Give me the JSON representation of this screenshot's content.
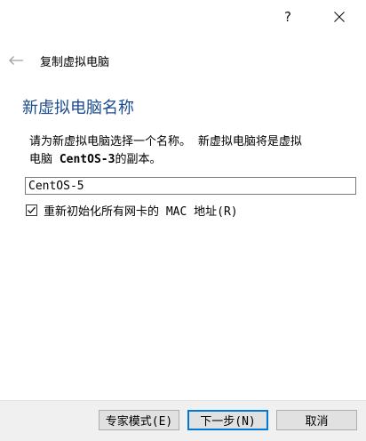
{
  "titlebar": {
    "help_label": "?"
  },
  "header": {
    "title": "复制虚拟电脑"
  },
  "page": {
    "heading": "新虚拟电脑名称",
    "description_line1": "请为新虚拟电脑选择一个名称。 新虚拟电脑将是虚拟",
    "description_line2_prefix": "电脑 ",
    "description_source_vm": "CentOS-3",
    "description_line2_suffix": "的副本。",
    "name_value": "CentOS-5",
    "reinit_mac_checked": true,
    "reinit_mac_label": "重新初始化所有网卡的 MAC 地址(R)"
  },
  "buttons": {
    "expert": "专家模式(E)",
    "next": "下一步(N)",
    "cancel": "取消"
  },
  "colors": {
    "heading": "#1a4b8c",
    "focus_border": "#0078d7",
    "footer_bg": "#f0f0f0"
  },
  "icons": {
    "back": "back-arrow-icon",
    "close": "close-icon",
    "check": "checkmark-icon"
  }
}
